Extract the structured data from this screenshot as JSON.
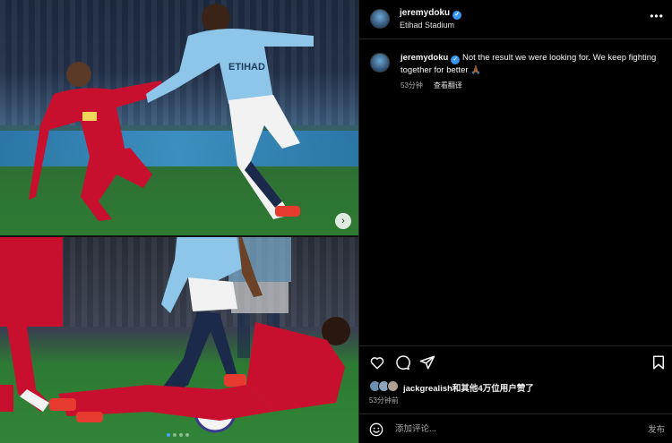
{
  "post": {
    "username": "jeremydoku",
    "location": "Etihad Stadium",
    "caption": "Not the result we were looking for. We keep fighting together for better 🙏🏾",
    "caption_time": "53分钟",
    "translate_label": "查看翻译",
    "likes_text": "jackgrealish和其他4万位用户赞了",
    "post_time": "53分钟前",
    "comment_placeholder": "添加评论...",
    "post_button": "发布"
  },
  "media": {
    "image_count": 2,
    "current_index": 1,
    "next_icon": "chevron-right-icon",
    "ad_text": "ETIHAD"
  },
  "icons": {
    "more": "more-horizontal-icon",
    "like": "heart-icon",
    "comment": "comment-icon",
    "share": "share-icon",
    "save": "bookmark-icon",
    "emoji": "emoji-icon"
  },
  "colors": {
    "background": "#000000",
    "verified": "#3897f0",
    "divider": "#262626",
    "liverpool_red": "#c8102e",
    "city_blue": "#8ec6ea"
  }
}
